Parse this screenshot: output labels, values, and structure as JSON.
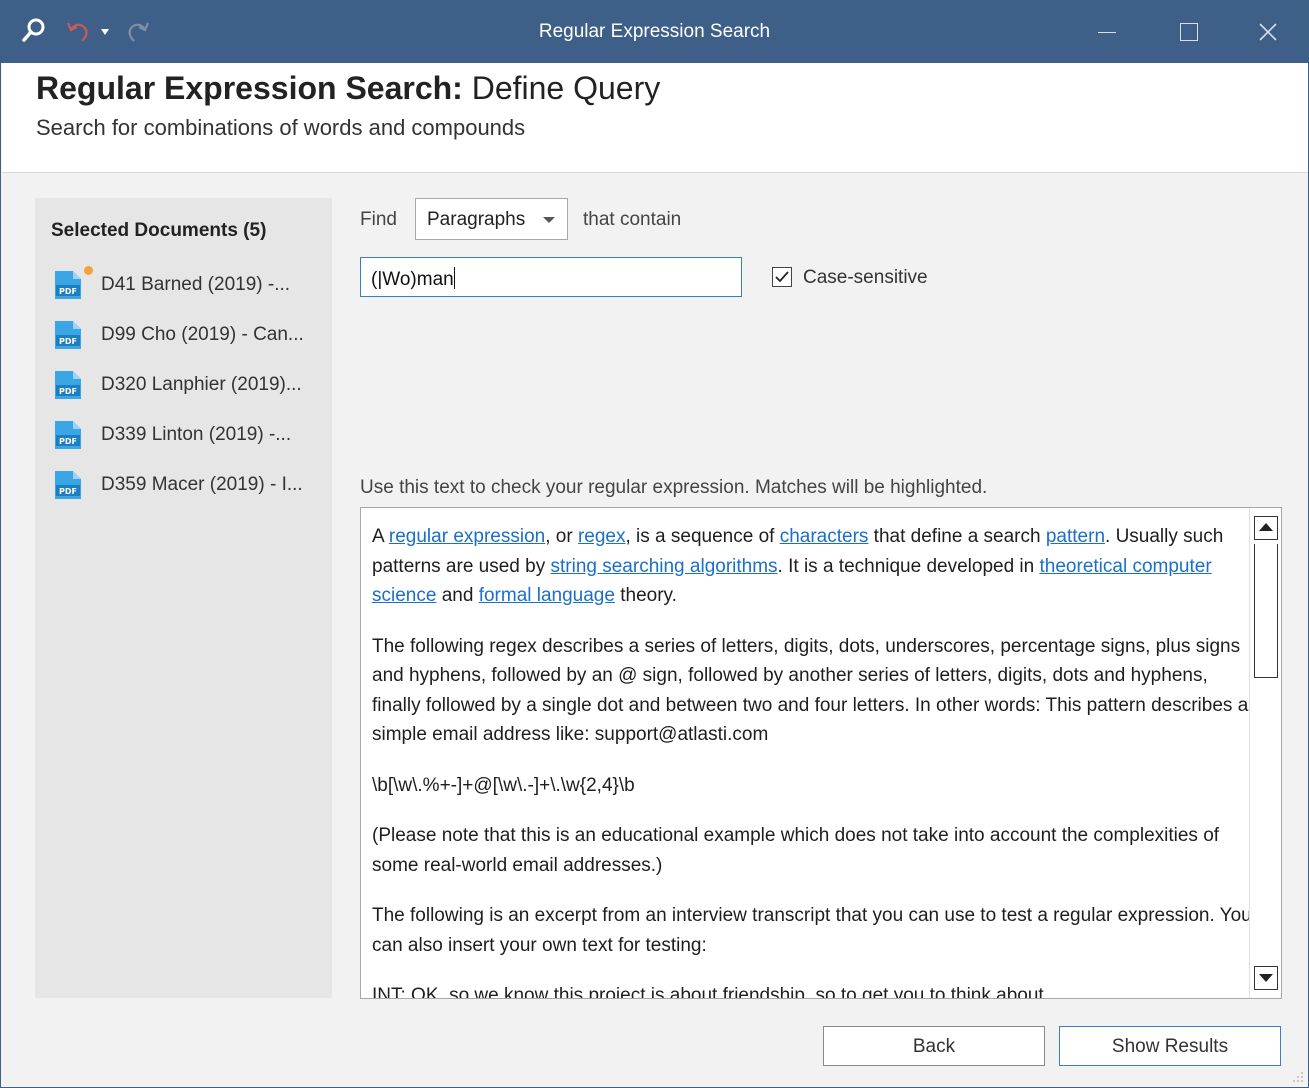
{
  "window": {
    "title": "Regular Expression Search",
    "accent": "#3d5f88"
  },
  "header": {
    "title_bold": "Regular Expression Search:",
    "title_rest": " Define Query",
    "subtitle": "Search for combinations of words and compounds"
  },
  "sidebar": {
    "heading": "Selected Documents (5)",
    "documents": [
      {
        "label": "D41 Barned (2019) -...",
        "icon": "pdf-icon",
        "modified": true
      },
      {
        "label": "D99 Cho (2019) - Can...",
        "icon": "pdf-icon",
        "modified": false
      },
      {
        "label": "D320 Lanphier (2019)...",
        "icon": "pdf-icon",
        "modified": false
      },
      {
        "label": "D339 Linton (2019) -...",
        "icon": "pdf-icon",
        "modified": false
      },
      {
        "label": "D359 Macer (2019) - I...",
        "icon": "pdf-icon",
        "modified": false
      }
    ]
  },
  "query": {
    "find_label": "Find",
    "scope_value": "Paragraphs",
    "contain_label": "that contain",
    "regex_value": "(|Wo)man",
    "case_sensitive_label": "Case-sensitive",
    "case_sensitive_checked": true
  },
  "test": {
    "hint": "Use this text to check your regular expression. Matches will be highlighted.",
    "p1": {
      "t0": "A ",
      "l1": "regular expression",
      "t1": ", or ",
      "l2": "regex",
      "t2": ", is a sequence of ",
      "l3": "characters",
      "t3": " that define a search ",
      "l4": "pattern",
      "t4": ". Usually such patterns are used by ",
      "l5": "string searching algorithms",
      "t5": ". It is a technique developed in ",
      "l6": "theoretical computer science",
      "t6": " and ",
      "l7": "formal language",
      "t7": " theory."
    },
    "p2": "The following regex describes a series of letters, digits, dots, underscores, percentage signs, plus signs and hyphens, followed by an @ sign, followed by another series of letters, digits, dots and hyphens, finally followed by a single dot and between two and four letters. In other words: This pattern describes a simple email address like: support@atlasti.com",
    "p3": "\\b[\\w\\.%+-]+@[\\w\\.-]+\\.\\w{2,4}\\b",
    "p4": "(Please note that this is an educational example which does not take into account the complexities of some real-world email addresses.)",
    "p5": "The following is an excerpt from an interview transcript that you can use to test a regular expression. You can also insert your own text for testing:",
    "p6": "INT: OK, so we know this project is about friendship, so to get you to think about"
  },
  "buttons": {
    "back": "Back",
    "show_results": "Show Results"
  }
}
